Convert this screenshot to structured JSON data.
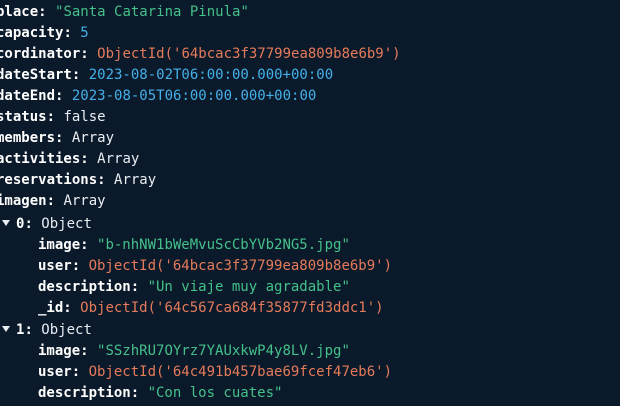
{
  "doc": {
    "place": {
      "key": "place",
      "value": "\"Santa Catarina Pinula\""
    },
    "capacity": {
      "key": "capacity",
      "value": "5"
    },
    "cordinator": {
      "key": "cordinator",
      "value": "ObjectId('64bcac3f37799ea809b8e6b9')"
    },
    "dateStart": {
      "key": "dateStart",
      "value": "2023-08-02T06:00:00.000+00:00"
    },
    "dateEnd": {
      "key": "dateEnd",
      "value": "2023-08-05T06:00:00.000+00:00"
    },
    "status": {
      "key": "status",
      "value": "false"
    },
    "members": {
      "key": "members",
      "value": "Array"
    },
    "activities": {
      "key": "activities",
      "value": "Array"
    },
    "reservations": {
      "key": "reservations",
      "value": "Array"
    },
    "imagen": {
      "key": "imagen",
      "value": "Array"
    },
    "items": [
      {
        "index": "0",
        "type": "Object",
        "image": {
          "key": "image",
          "value": "\"b-nhNW1bWeMvuScCbYVb2NG5.jpg\""
        },
        "user": {
          "key": "user",
          "value": "ObjectId('64bcac3f37799ea809b8e6b9')"
        },
        "description": {
          "key": "description",
          "value": "\"Un viaje muy agradable\""
        },
        "id": {
          "key": "_id",
          "value": "ObjectId('64c567ca684f35877fd3ddc1')"
        }
      },
      {
        "index": "1",
        "type": "Object",
        "image": {
          "key": "image",
          "value": "\"SSzhRU7OYrz7YAUxkwP4y8LV.jpg\""
        },
        "user": {
          "key": "user",
          "value": "ObjectId('64c491b457bae69fcef47eb6')"
        },
        "description": {
          "key": "description",
          "value": "\"Con los cuates\""
        }
      }
    ]
  }
}
